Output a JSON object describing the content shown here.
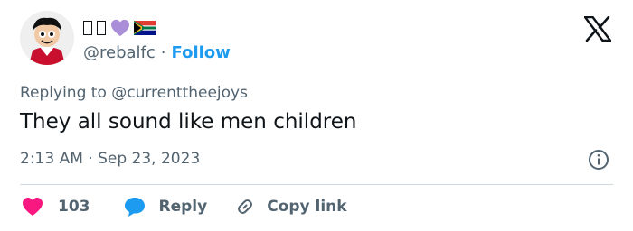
{
  "author": {
    "display_name_glyphs": "□□",
    "emoji_heart": "purple-heart",
    "emoji_flag": "south-africa-flag",
    "handle": "@rebalfc",
    "separator": "·",
    "follow_label": "Follow"
  },
  "reply_context": {
    "prefix": "Replying to",
    "mention": "@currenttheejoys"
  },
  "tweet": {
    "text": "They all sound like men children",
    "time": "2:13 AM",
    "separator": "·",
    "date": "Sep 23, 2023"
  },
  "actions": {
    "like_count": "103",
    "reply_label": "Reply",
    "copy_label": "Copy link"
  },
  "colors": {
    "accent": "#1d9bf0",
    "like": "#f91880",
    "muted": "#536471",
    "text": "#0f1419"
  }
}
